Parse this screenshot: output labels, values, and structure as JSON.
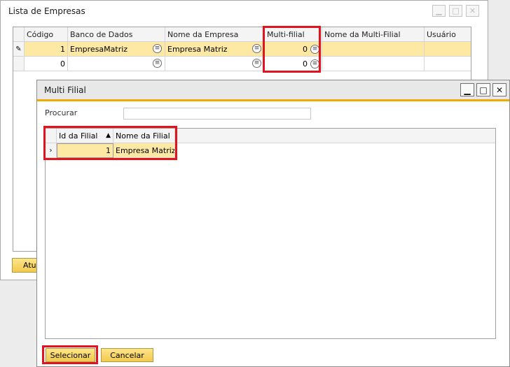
{
  "back_window": {
    "title": "Lista de Empresas",
    "columns": [
      "Código",
      "Banco de Dados",
      "Nome da Empresa",
      "Multi-filial",
      "Nome da Multi-Filial",
      "Usuário"
    ],
    "rows": [
      {
        "codigo": "1",
        "banco": "EmpresaMatriz",
        "nome": "Empresa Matriz",
        "multi": "0",
        "nome_multi": "",
        "usuario": ""
      },
      {
        "codigo": "0",
        "banco": "",
        "nome": "",
        "multi": "0",
        "nome_multi": "",
        "usuario": ""
      }
    ],
    "update_button": "Atualizar"
  },
  "front_window": {
    "title": "Multi Filial",
    "search_label": "Procurar",
    "search_value": "",
    "columns": [
      "Id da Filial",
      "Nome da Filial"
    ],
    "sort_indicator": "▲",
    "rows": [
      {
        "id": "1",
        "nome": "Empresa Matriz"
      }
    ],
    "select_button": "Selecionar",
    "cancel_button": "Cancelar"
  },
  "colors": {
    "selected_row": "#fde9a3",
    "accent_orange": "#f0ab00",
    "highlight_red": "#e0141e"
  }
}
